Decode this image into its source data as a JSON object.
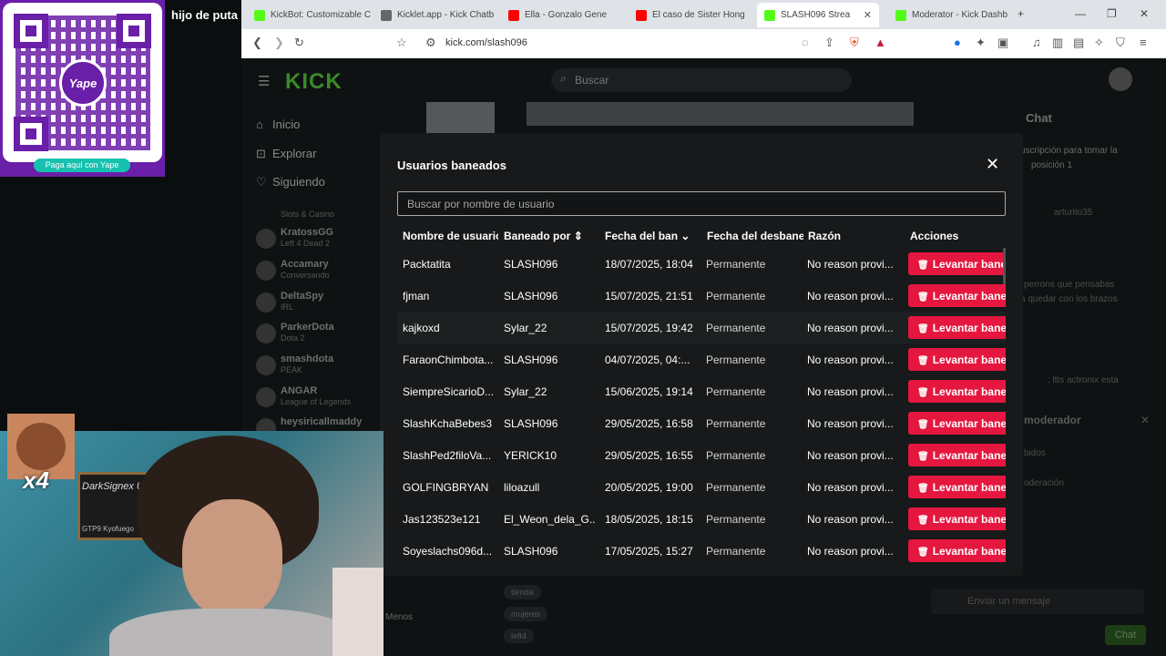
{
  "overlay": {
    "qr_brand": "Yape",
    "qr_pay_label": "Paga aquí con Yape",
    "chat_message": "hijo de puta"
  },
  "browser": {
    "tabs": [
      {
        "title": "KickBot: Customizable C",
        "color": "#53fc18"
      },
      {
        "title": "Kicklet.app - Kick Chatb",
        "color": "#666666"
      },
      {
        "title": "Ella - Gonzalo Gene",
        "color": "#ff0000"
      },
      {
        "title": "El caso de Sister Hong",
        "color": "#ff0000"
      },
      {
        "title": "SLASH096 Strea",
        "color": "#53fc18"
      },
      {
        "title": "Moderator - Kick Dashb",
        "color": "#53fc18"
      }
    ],
    "url": "kick.com/slash096"
  },
  "kick": {
    "logo": "KICK",
    "search_placeholder": "Buscar",
    "nav": [
      {
        "label": "Inicio",
        "icon": "home-icon"
      },
      {
        "label": "Explorar",
        "icon": "compass-icon"
      },
      {
        "label": "Siguiendo",
        "icon": "heart-icon"
      }
    ],
    "channels": [
      {
        "name": "Slots & Casino",
        "game": ""
      },
      {
        "name": "KratossGG",
        "game": "Left 4 Dead 2"
      },
      {
        "name": "Accamary",
        "game": "Conversando"
      },
      {
        "name": "DeltaSpy",
        "game": "IRL"
      },
      {
        "name": "ParkerDota",
        "game": "Dota 2"
      },
      {
        "name": "smashdota",
        "game": "PEAK"
      },
      {
        "name": "ANGAR",
        "game": "League of Legends"
      },
      {
        "name": "heysiricallmaddy",
        "game": ""
      }
    ],
    "menos_label": "Menos",
    "tags": [
      "tienda",
      "mujeres",
      "left4"
    ],
    "chat": {
      "title": "Chat",
      "sub_prompt": "uscripción para tomar la",
      "sub_prompt2": "posición 1",
      "pinned_user": "arturito35",
      "msg1": "perrons que pensabas",
      "msg2": "a quedar con los brazos",
      "msg3": ": ltts actronix esta",
      "mod_title": "moderador",
      "mod_opt1": "bidos",
      "mod_opt2": "oderación",
      "input_placeholder": "Enviar un mensaje",
      "send_label": "Chat"
    }
  },
  "modal": {
    "title": "Usuarios baneados",
    "search_placeholder": "Buscar por nombre de usuario",
    "columns": {
      "username": "Nombre de usuario",
      "banned_by": "Baneado por",
      "ban_date": "Fecha del ban",
      "unban_date": "Fecha del desbaneo",
      "reason": "Razón",
      "actions": "Acciones"
    },
    "unban_label": "Levantar baneo",
    "rows": [
      {
        "user": "Packtatita",
        "by": "SLASH096",
        "date": "18/07/2025, 18:04",
        "until": "Permanente",
        "reason": "No reason provi..."
      },
      {
        "user": "fjman",
        "by": "SLASH096",
        "date": "15/07/2025, 21:51",
        "until": "Permanente",
        "reason": "No reason provi..."
      },
      {
        "user": "kajkoxd",
        "by": "Sylar_22",
        "date": "15/07/2025, 19:42",
        "until": "Permanente",
        "reason": "No reason provi..."
      },
      {
        "user": "FaraonChimbota...",
        "by": "SLASH096",
        "date": "04/07/2025, 04:...",
        "until": "Permanente",
        "reason": "No reason provi..."
      },
      {
        "user": "SiempreSicarioD...",
        "by": "Sylar_22",
        "date": "15/06/2025, 19:14",
        "until": "Permanente",
        "reason": "No reason provi..."
      },
      {
        "user": "SlashKchaBebes3",
        "by": "SLASH096",
        "date": "29/05/2025, 16:58",
        "until": "Permanente",
        "reason": "No reason provi..."
      },
      {
        "user": "SlashPed2filoVa...",
        "by": "YERICK10",
        "date": "29/05/2025, 16:55",
        "until": "Permanente",
        "reason": "No reason provi..."
      },
      {
        "user": "GOLFINGBRYAN",
        "by": "liloazull",
        "date": "20/05/2025, 19:00",
        "until": "Permanente",
        "reason": "No reason provi..."
      },
      {
        "user": "Jas123523e121",
        "by": "El_Weon_dela_G...",
        "date": "18/05/2025, 18:15",
        "until": "Permanente",
        "reason": "No reason provi..."
      },
      {
        "user": "Soyeslachs096d...",
        "by": "SLASH096",
        "date": "17/05/2025, 15:27",
        "until": "Permanente",
        "reason": "No reason provi..."
      }
    ]
  },
  "webcam": {
    "emote_multiplier": "x4",
    "shelf_text": "DarkSignex Usurlage",
    "shelf_sub": "GTP9 Kyofuego"
  },
  "colors": {
    "accent": "#53fc18",
    "danger": "#e5173f",
    "modal_bg": "#17191a",
    "yape": "#6a1fa8"
  }
}
